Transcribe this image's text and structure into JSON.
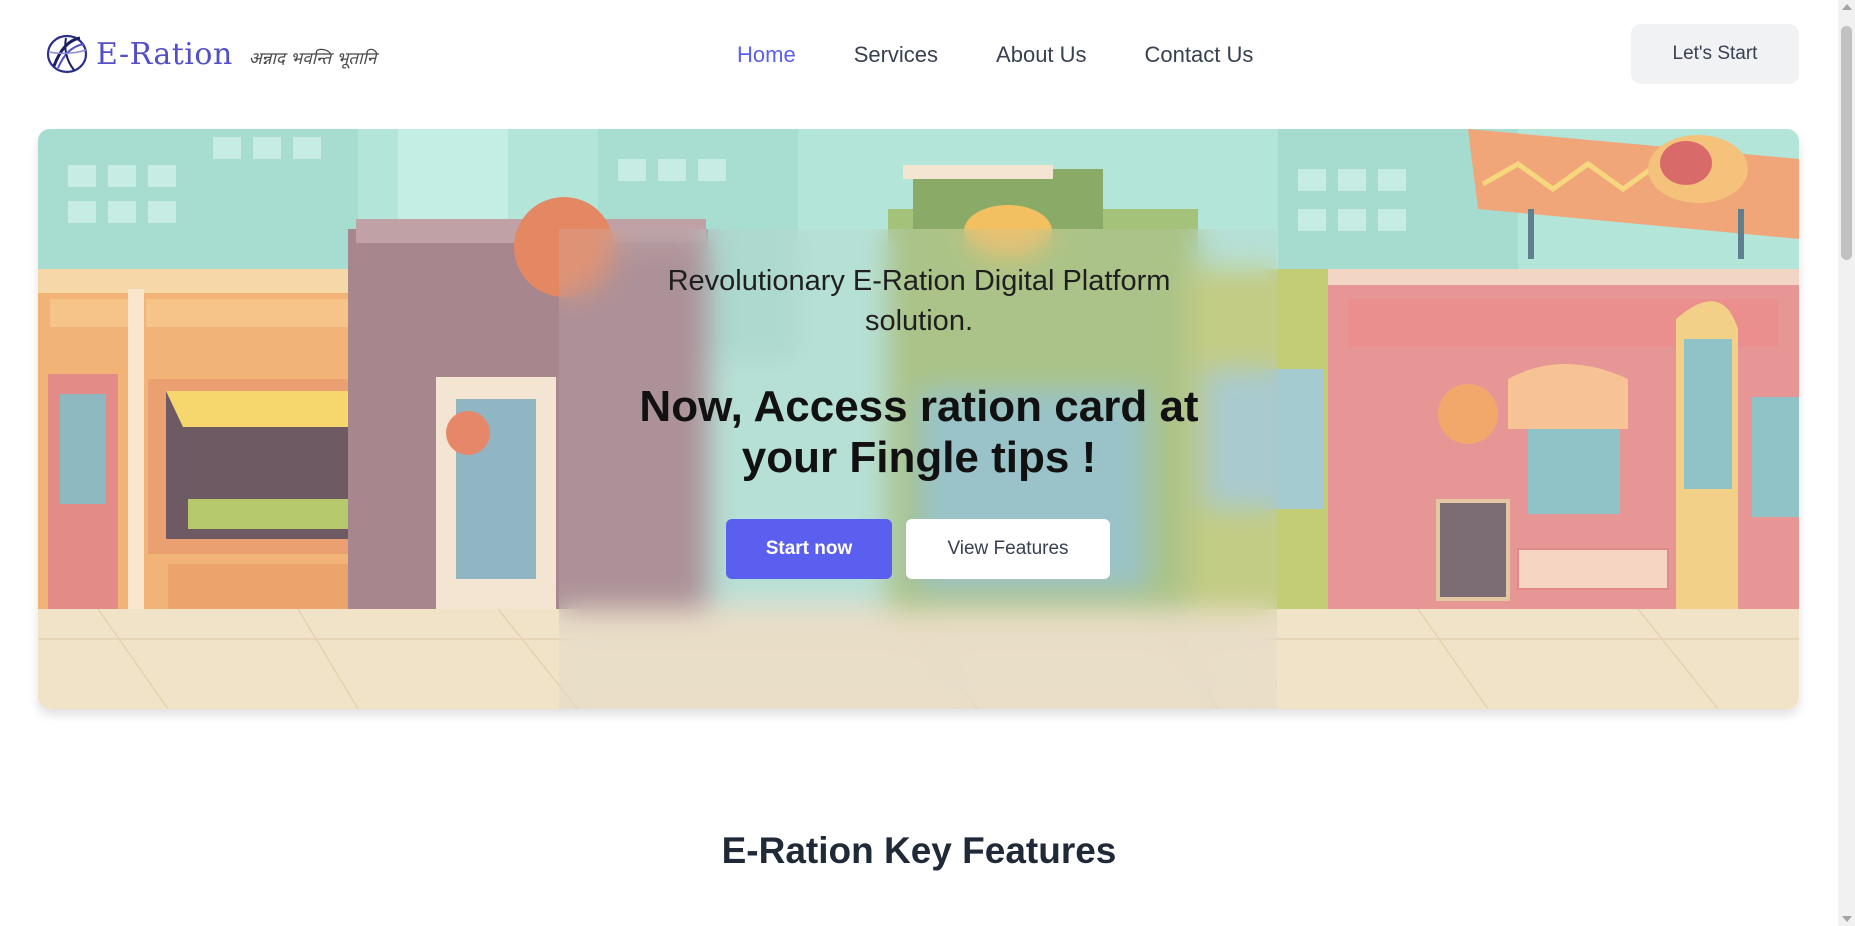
{
  "brand": {
    "name": "E-Ration",
    "tagline": "अन्नाद भवन्ति भूतानि"
  },
  "nav": {
    "items": [
      {
        "label": "Home",
        "active": true
      },
      {
        "label": "Services",
        "active": false
      },
      {
        "label": "About Us",
        "active": false
      },
      {
        "label": "Contact Us",
        "active": false
      }
    ],
    "cta_label": "Let's Start"
  },
  "hero": {
    "subtitle": "Revolutionary E-Ration Digital Platform solution.",
    "title": "Now, Access ration card at your Fingle tips !",
    "primary_button": "Start now",
    "secondary_button": "View Features"
  },
  "features": {
    "heading": "E-Ration Key Features"
  },
  "colors": {
    "accent": "#5b5ff0",
    "brand": "#5350c7",
    "text": "#1f2937"
  }
}
